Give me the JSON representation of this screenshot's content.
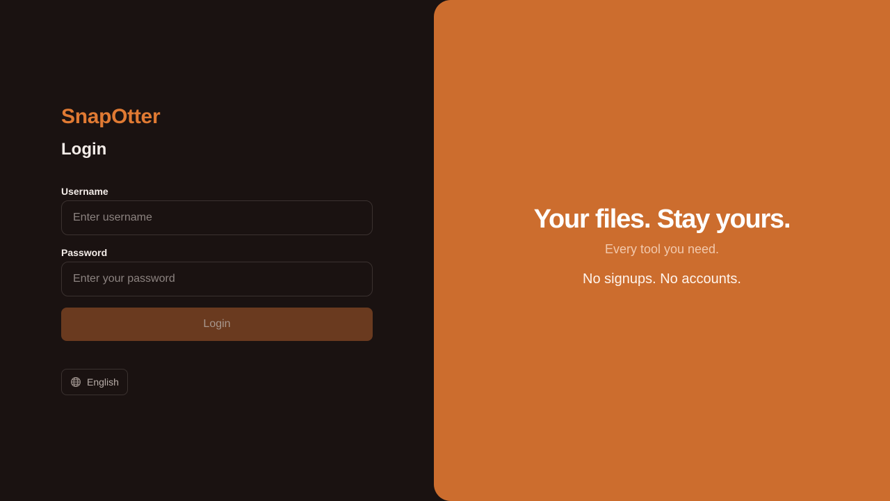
{
  "brand": {
    "name": "SnapOtter",
    "color": "#e07a33"
  },
  "login": {
    "heading": "Login",
    "username": {
      "label": "Username",
      "placeholder": "Enter username",
      "value": ""
    },
    "password": {
      "label": "Password",
      "placeholder": "Enter your password",
      "value": ""
    },
    "submit_label": "Login",
    "submit_disabled": true
  },
  "language": {
    "icon": "globe-icon",
    "selected": "English"
  },
  "hero": {
    "title": "Your files. Stay yours.",
    "subtitle": "Every tool you need.",
    "tagline": "No signups. No accounts.",
    "background": "#cc6d2e"
  },
  "colors": {
    "page_background": "#1a1211",
    "button_disabled": "#6a3a1f"
  }
}
